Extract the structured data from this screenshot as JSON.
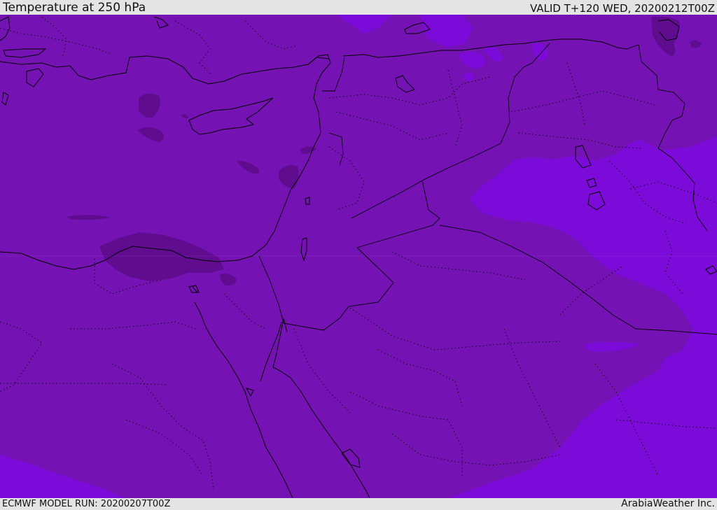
{
  "header": {
    "title": "Temperature at 250 hPa",
    "valid_time": "VALID T+120 WED, 20200212T00Z"
  },
  "footer": {
    "model_run": "ECMWF MODEL RUN: 20200207T00Z",
    "credit": "ArabiaWeather Inc."
  },
  "map": {
    "variable": "temperature",
    "pressure_level_hpa": 250,
    "colors": {
      "base_field": "#7512b4",
      "warmer_field": "#7c0ad9",
      "warmer_field_edge": "#7f07e8",
      "colder_pockets": "#5f0c8e",
      "coastline": "#000000",
      "borders": "#000000"
    }
  }
}
